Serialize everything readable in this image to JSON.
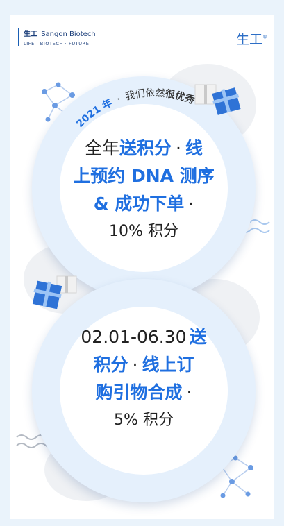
{
  "header": {
    "brand_cn": "生工",
    "brand_en": "Sangon Biotech",
    "tagline": "LIFE · BIOTECH · FUTURE",
    "right_logo": "生工"
  },
  "arc": {
    "year": "2021 年",
    "dot": "·",
    "text": "我们依然",
    "bold": "很优秀"
  },
  "promo1": {
    "l1a": "全年",
    "l1b": "送积分",
    "l1c": "·",
    "l1d": "线",
    "l2": "上预约 DNA 测序",
    "l3a": "& 成功下单",
    "l3b": "·",
    "l4": "10% 积分"
  },
  "promo2": {
    "l1a": "02.01-06.30",
    "l1b": "送",
    "l2a": "积分",
    "l2b": "·",
    "l2c": "线上订",
    "l3a": "购引物合成",
    "l3b": "·",
    "l4": "5% 积分"
  },
  "colors": {
    "accent": "#1f6fe0",
    "ring": "#e5f0fc",
    "brand": "#1b3e7a"
  }
}
